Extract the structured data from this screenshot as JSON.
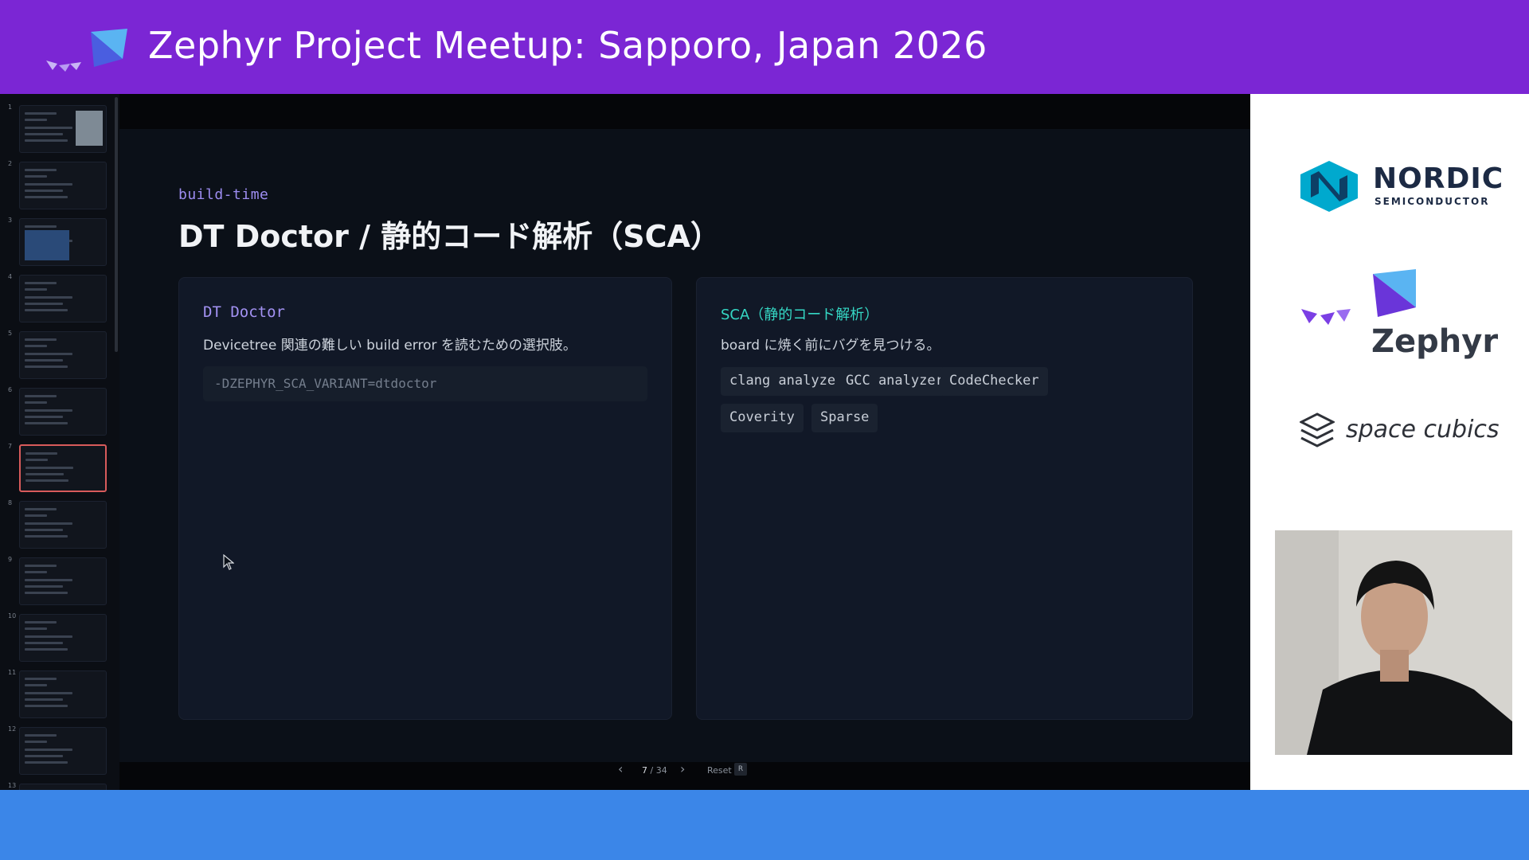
{
  "banner": {
    "title": "Zephyr Project Meetup: Sapporo, Japan 2026"
  },
  "thumbnails": {
    "active": 7,
    "items": [
      {
        "num": "1"
      },
      {
        "num": "2"
      },
      {
        "num": "3"
      },
      {
        "num": "4"
      },
      {
        "num": "5"
      },
      {
        "num": "6"
      },
      {
        "num": "7"
      },
      {
        "num": "8"
      },
      {
        "num": "9"
      },
      {
        "num": "10"
      },
      {
        "num": "11"
      },
      {
        "num": "12"
      },
      {
        "num": "13"
      }
    ]
  },
  "slide": {
    "eyebrow": "build-time",
    "title": "DT Doctor / 静的コード解析（SCA）",
    "left_card": {
      "heading": "DT Doctor",
      "description": "Devicetree 関連の難しい build error を読むための選択肢。",
      "code": "-DZEPHYR_SCA_VARIANT=dtdoctor"
    },
    "right_card": {
      "heading": "SCA（静的コード解析）",
      "description": "board に焼く前にバグを見つける。",
      "tags": [
        "clang analyzer",
        "GCC analyzer",
        "CodeChecker",
        "Coverity",
        "Sparse"
      ]
    }
  },
  "controls": {
    "prev_icon": "chevron-left-icon",
    "next_icon": "chevron-right-icon",
    "page_current": "7",
    "page_total": "/ 34",
    "reset_label": "Reset",
    "reset_key": "R"
  },
  "sponsors": {
    "nordic": {
      "name": "NORDIC",
      "tagline": "SEMICONDUCTOR"
    },
    "zephyr": {
      "name": "Zephyr"
    },
    "spacecubics": {
      "name": "space cubics"
    }
  },
  "colors": {
    "banner": "#7b26d4",
    "footer": "#3b86e8",
    "accent_purple": "#a392f3",
    "accent_teal": "#35d7c4",
    "active_thumb": "#d85b5b"
  }
}
